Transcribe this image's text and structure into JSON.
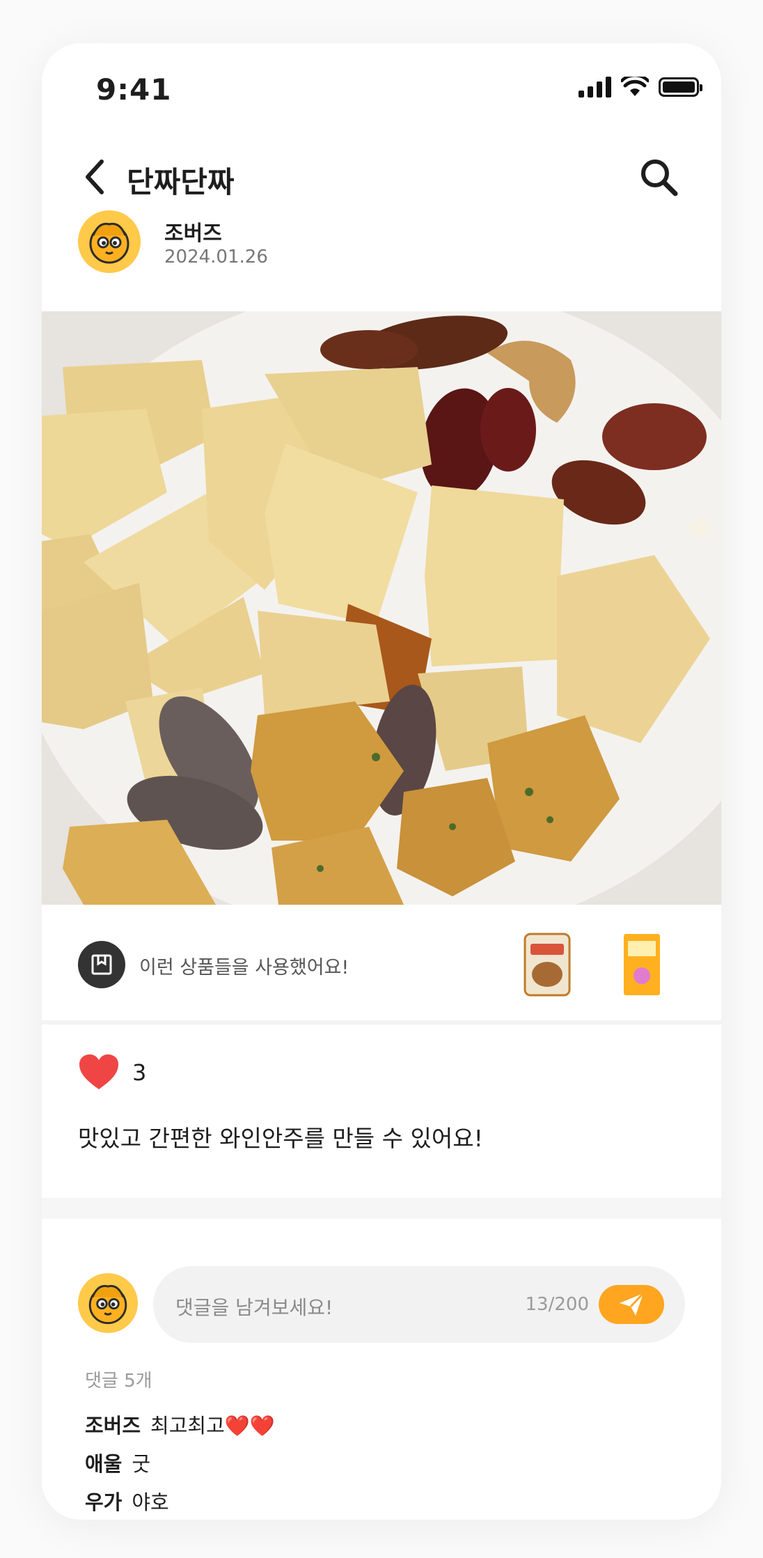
{
  "status_bar": {
    "time": "9:41"
  },
  "header": {
    "title": "단짜단짜",
    "back_icon": "chevron-left-icon",
    "search_icon": "search-icon"
  },
  "post": {
    "author": "조버즈",
    "date": "2024.01.26",
    "products_label": "이런 상품들을 사용했어요!",
    "like_count": "3",
    "description": "맛있고 간편한 와인안주를 만들 수 있어요!"
  },
  "comment_input": {
    "placeholder": "댓글을 남겨보세요!",
    "counter": "13/200"
  },
  "comments": {
    "count_label": "댓글 5개",
    "items": [
      {
        "user": "조버즈",
        "text": "최고최고❤️❤️"
      },
      {
        "user": "애울",
        "text": "굿"
      },
      {
        "user": "우가",
        "text": "야호"
      }
    ]
  },
  "colors": {
    "accent": "#ffa51f",
    "heart": "#f04545",
    "avatar_bg": "#ffc94a"
  }
}
